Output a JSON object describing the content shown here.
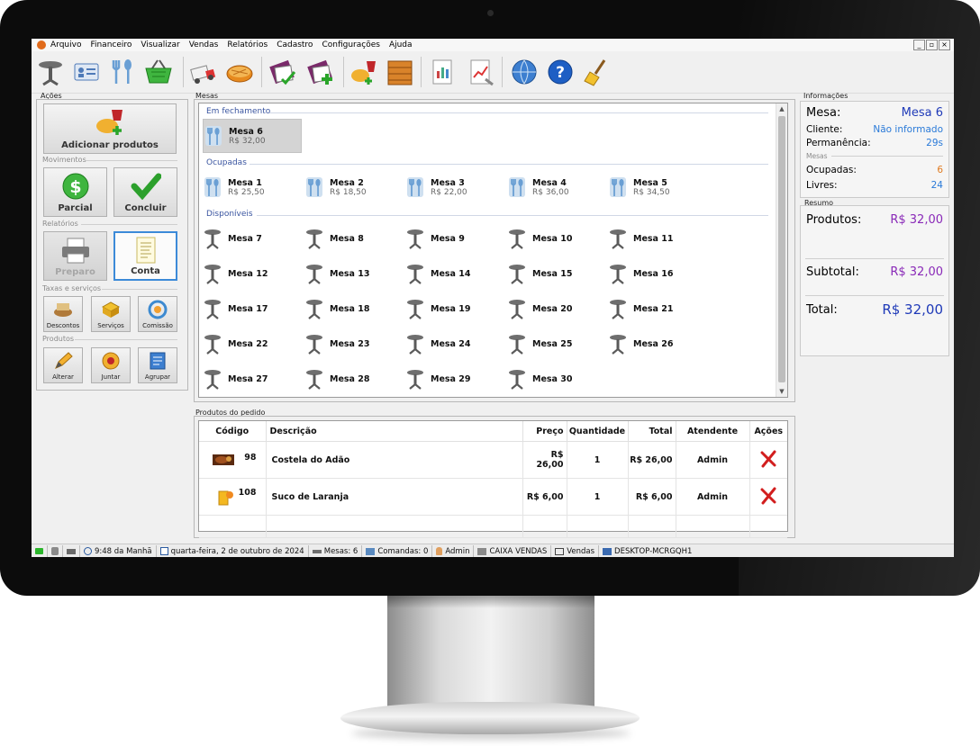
{
  "menu": [
    "Arquivo",
    "Financeiro",
    "Visualizar",
    "Vendas",
    "Relatórios",
    "Cadastro",
    "Configurações",
    "Ajuda"
  ],
  "window_controls": [
    "_",
    "▫",
    "×"
  ],
  "toolbar_icons": [
    "table-icon",
    "customer-card-icon",
    "cutlery-icon",
    "shopping-basket-icon",
    "delivery-truck-icon",
    "pie-icon",
    "product-list-icon",
    "add-product-icon",
    "combo-icon",
    "crate-icon",
    "report-icon",
    "chart-report-icon",
    "globe-icon",
    "help-icon",
    "broom-icon"
  ],
  "acoes": {
    "title": "Ações",
    "add_label": "Adicionar produtos",
    "movimentos_label": "Movimentos",
    "parcial_label": "Parcial",
    "concluir_label": "Concluir",
    "relatorios_label": "Relatórios",
    "preparo_label": "Preparo",
    "conta_label": "Conta",
    "taxas_label": "Taxas e serviços",
    "descontos_label": "Descontos",
    "servicos_label": "Serviços",
    "comissao_label": "Comissão",
    "produtos_label": "Produtos",
    "alterar_label": "Alterar",
    "juntar_label": "Juntar",
    "agrupar_label": "Agrupar"
  },
  "mesas": {
    "title": "Mesas",
    "fechamento_title": "Em fechamento",
    "fechamento": [
      {
        "name": "Mesa 6",
        "price": "R$ 32,00"
      }
    ],
    "ocupadas_title": "Ocupadas",
    "ocupadas": [
      {
        "name": "Mesa 1",
        "price": "R$ 25,50"
      },
      {
        "name": "Mesa 2",
        "price": "R$ 18,50"
      },
      {
        "name": "Mesa 3",
        "price": "R$ 22,00"
      },
      {
        "name": "Mesa 4",
        "price": "R$ 36,00"
      },
      {
        "name": "Mesa 5",
        "price": "R$ 34,50"
      }
    ],
    "disponiveis_title": "Disponíveis",
    "disponiveis": [
      "Mesa 7",
      "Mesa 8",
      "Mesa 9",
      "Mesa 10",
      "Mesa 11",
      "Mesa 12",
      "Mesa 13",
      "Mesa 14",
      "Mesa 15",
      "Mesa 16",
      "Mesa 17",
      "Mesa 18",
      "Mesa 19",
      "Mesa 20",
      "Mesa 21",
      "Mesa 22",
      "Mesa 23",
      "Mesa 24",
      "Mesa 25",
      "Mesa 26",
      "Mesa 27",
      "Mesa 28",
      "Mesa 29",
      "Mesa 30"
    ]
  },
  "produtos": {
    "title": "Produtos do pedido",
    "columns": [
      "Código",
      "Descrição",
      "Preço",
      "Quantidade",
      "Total",
      "Atendente",
      "Ações"
    ],
    "rows": [
      {
        "code": "98",
        "desc": "Costela do Adão",
        "price": "R$ 26,00",
        "qty": "1",
        "total": "R$ 26,00",
        "atendente": "Admin"
      },
      {
        "code": "108",
        "desc": "Suco de Laranja",
        "price": "R$ 6,00",
        "qty": "1",
        "total": "R$ 6,00",
        "atendente": "Admin"
      }
    ]
  },
  "info": {
    "title": "Informações",
    "mesa_label": "Mesa:",
    "mesa_value": "Mesa 6",
    "cliente_label": "Cliente:",
    "cliente_value": "Não informado",
    "permanencia_label": "Permanência:",
    "permanencia_value": "29s",
    "mesas_sub": "Mesas",
    "ocupadas_label": "Ocupadas:",
    "ocupadas_value": "6",
    "livres_label": "Livres:",
    "livres_value": "24"
  },
  "resumo": {
    "title": "Resumo",
    "produtos_label": "Produtos:",
    "produtos_value": "R$ 32,00",
    "subtotal_label": "Subtotal:",
    "subtotal_value": "R$ 32,00",
    "total_label": "Total:",
    "total_value": "R$ 32,00"
  },
  "status": {
    "time": "9:48 da Manhã",
    "date": "quarta-feira, 2 de outubro de 2024",
    "mesas": "Mesas: 6",
    "comandas": "Comandas: 0",
    "user": "Admin",
    "caixa": "CAIXA VENDAS",
    "vendas": "Vendas",
    "computer": "DESKTOP-MCRGQH1"
  },
  "colors": {
    "accent_blue": "#1f3ab8",
    "purple": "#8a2ab8",
    "orange": "#e07a20",
    "link_blue": "#2a7ad8",
    "section_blue": "#3a55a0",
    "delete_red": "#d21e1e"
  }
}
